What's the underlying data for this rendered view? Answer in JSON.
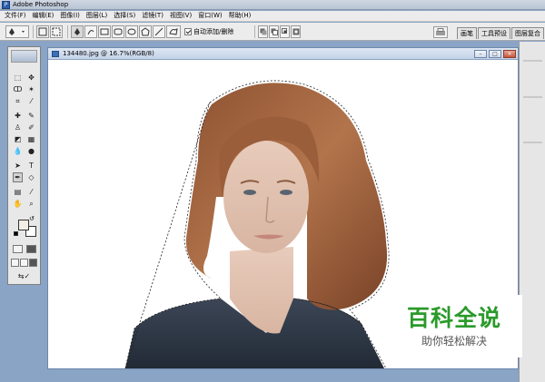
{
  "app": {
    "title": "Adobe Photoshop"
  },
  "menu": {
    "items": [
      "文件(F)",
      "编辑(E)",
      "图像(I)",
      "图层(L)",
      "选择(S)",
      "滤镜(T)",
      "视图(V)",
      "窗口(W)",
      "帮助(H)"
    ]
  },
  "options_bar": {
    "auto_add_label": "自动添加/删除",
    "auto_add_checked": true,
    "palette_tabs": [
      "画笔",
      "工具预设",
      "图层复合"
    ]
  },
  "document": {
    "title": "134480.jpg @ 16.7%(RGB/8)",
    "zoom": "16.7%",
    "color_mode": "RGB/8"
  },
  "toolbox": {
    "foreground_color": "#f3efe6",
    "background_color": "#ffffff"
  },
  "watermark": {
    "title": "百科全说",
    "subtitle": "助你轻松解决"
  },
  "colors": {
    "workspace": "#8aa4c6",
    "watermark_green": "#2a9a2a"
  }
}
